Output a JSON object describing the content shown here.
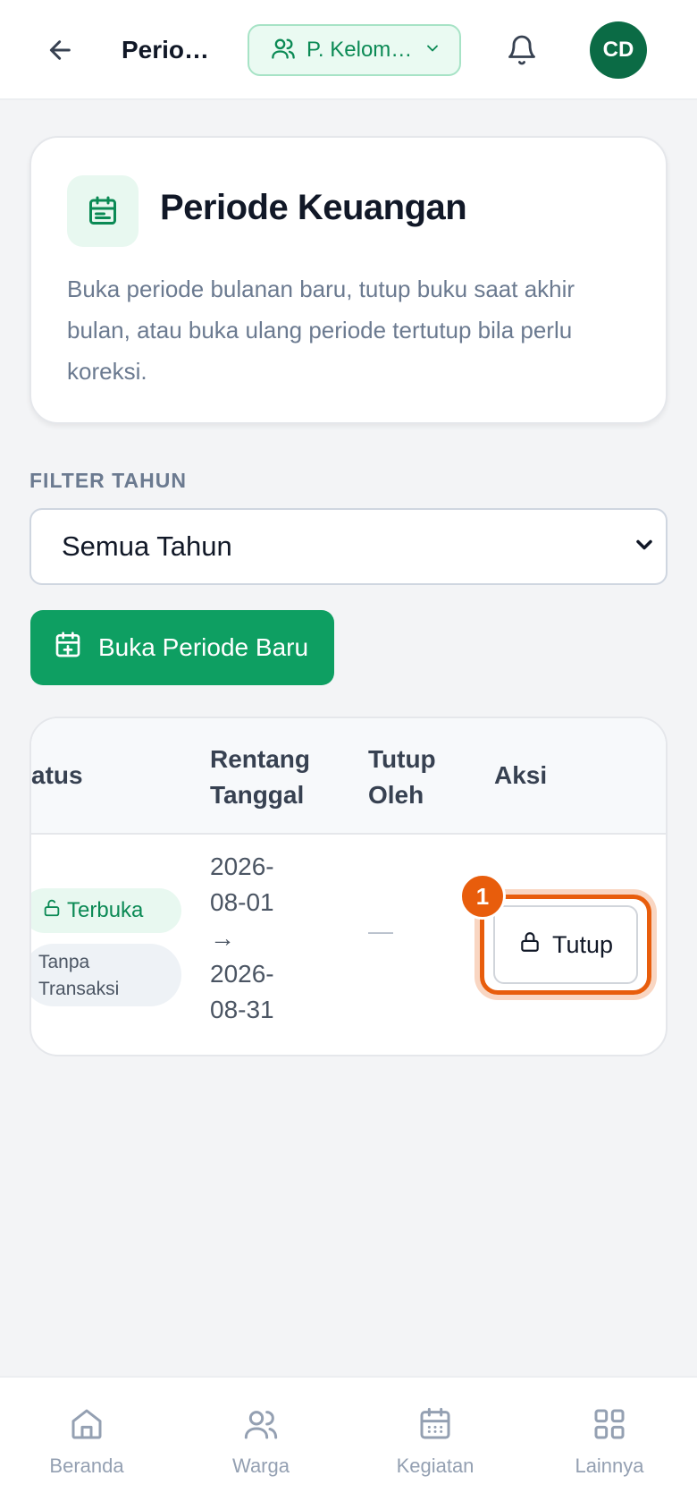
{
  "header": {
    "title": "Periode Keuangan",
    "group_label": "P. Kelompok",
    "avatar_initials": "CD"
  },
  "info_card": {
    "title": "Periode Keuangan",
    "description": "Buka periode bulanan baru, tutup buku saat akhir bulan, atau buka ulang periode tertutup bila perlu koreksi."
  },
  "filter": {
    "label": "FILTER TAHUN",
    "selected": "Semua Tahun"
  },
  "open_period_button": "Buka Periode Baru",
  "table": {
    "headers": {
      "status": "Status",
      "range_line1": "Rentang",
      "range_line2": "Tanggal",
      "closed_by_line1": "Tutup",
      "closed_by_line2": "Oleh",
      "action": "Aksi"
    },
    "rows": [
      {
        "status_badge": "Terbuka",
        "tx_badge_line1": "Tanpa",
        "tx_badge_line2": "Transaksi",
        "start_year": "2026-",
        "start_md": "08-01",
        "arrow": "→",
        "end_year": "2026-",
        "end_md": "08-31",
        "closed_by": "—",
        "action_label": "Tutup"
      }
    ]
  },
  "annotation": {
    "step": "1"
  },
  "bottom_nav": {
    "items": [
      {
        "label": "Beranda",
        "icon": "home-icon"
      },
      {
        "label": "Warga",
        "icon": "users-icon"
      },
      {
        "label": "Kegiatan",
        "icon": "calendar-icon"
      },
      {
        "label": "Lainnya",
        "icon": "grid-icon"
      }
    ]
  },
  "colors": {
    "brand": "#0e9f62",
    "brand_dark": "#0b6b45",
    "highlight": "#e85d0c"
  }
}
